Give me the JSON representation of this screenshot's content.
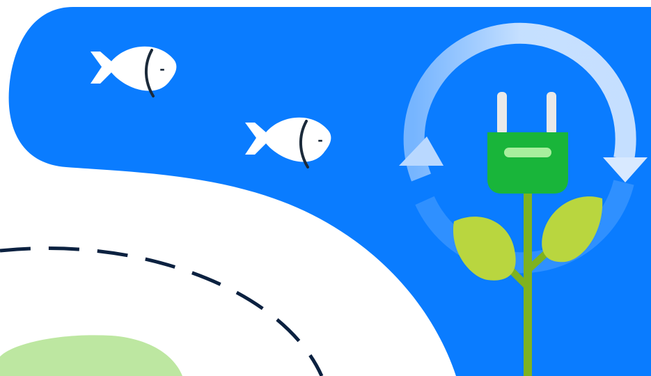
{
  "colors": {
    "background": "#ffffff",
    "water": "#0a7cff",
    "fish": "#ffffff",
    "fish_line": "#1b2a3a",
    "road_dash": "#0b2140",
    "grass": "#bde7a1",
    "plug_body": "#19b53a",
    "plug_slot": "#a8ef9d",
    "plug_prongs": "#e9e9e9",
    "stem": "#7fb21f",
    "leaf": "#b9d63f",
    "cycle_arrow": "#cfe4ff"
  },
  "icons": [
    "fish-icon",
    "fish-icon",
    "electric-plug-icon",
    "recycle-arrows-icon",
    "leaf-icon",
    "leaf-icon"
  ],
  "fish": [
    {
      "name": "fish-1",
      "mark": "-"
    },
    {
      "name": "fish-2",
      "mark": "-"
    }
  ]
}
